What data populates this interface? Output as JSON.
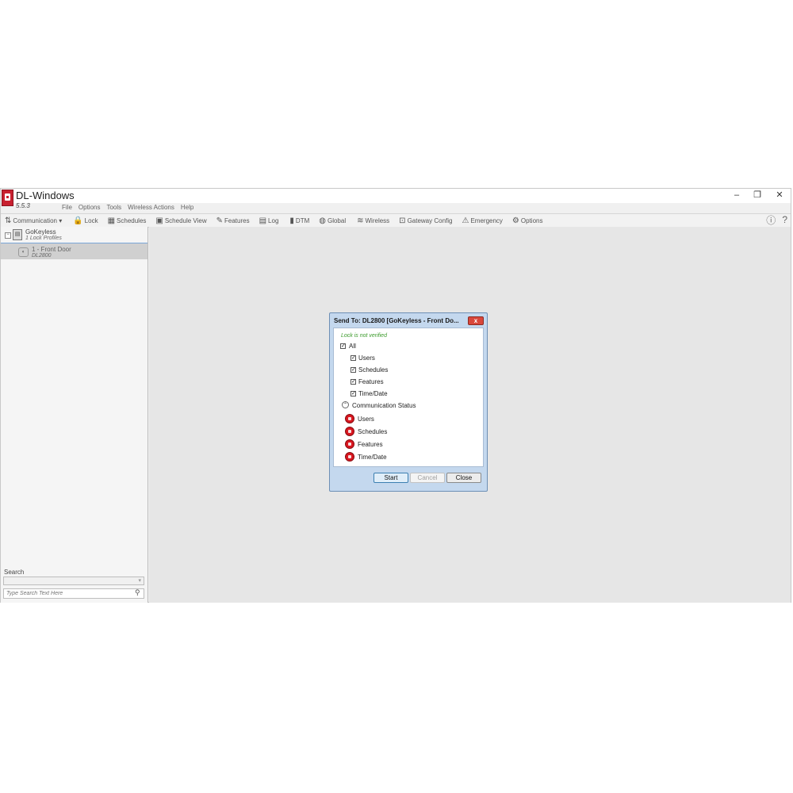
{
  "window": {
    "title": "DL-Windows",
    "version": "5.5.3",
    "controls": [
      "–",
      "❐",
      "✕"
    ]
  },
  "menu": [
    "File",
    "Options",
    "Tools",
    "Wireless Actions",
    "Help"
  ],
  "toolbar": [
    {
      "label": "Communication ▾",
      "icon": "communication-icon",
      "glyph": "⇅"
    },
    {
      "label": "Lock",
      "icon": "lock-icon",
      "glyph": "🔒"
    },
    {
      "label": "Schedules",
      "icon": "schedules-icon",
      "glyph": "▦"
    },
    {
      "label": "Schedule View",
      "icon": "calendar-icon",
      "glyph": "▣"
    },
    {
      "label": "Features",
      "icon": "tools-icon",
      "glyph": "✎"
    },
    {
      "label": "Log",
      "icon": "log-icon",
      "glyph": "▤"
    },
    {
      "label": "DTM",
      "icon": "dtm-icon",
      "glyph": "▮"
    },
    {
      "label": "Global",
      "icon": "globe-icon",
      "glyph": "◍"
    },
    {
      "label": "Wireless",
      "icon": "wireless-icon",
      "glyph": "≋"
    },
    {
      "label": "Gateway Config",
      "icon": "gateway-icon",
      "glyph": "⊡"
    },
    {
      "label": "Emergency",
      "icon": "emergency-icon",
      "glyph": "⚠"
    },
    {
      "label": "Options",
      "icon": "gear-icon",
      "glyph": "⚙"
    }
  ],
  "help_icons": {
    "info": "ⓘ",
    "help": "?"
  },
  "tree": {
    "expander": "−",
    "profile_icon": "▤",
    "profile_name": "GoKeyless",
    "profile_sub": "1 Lock Profiles",
    "lock_icon": "◐",
    "lock_name": "1 - Front Door",
    "lock_model": "DL2800"
  },
  "search": {
    "label": "Search",
    "dropdown_arrow": "▾",
    "placeholder": "Type Search Text Here",
    "icon": "⚲"
  },
  "dialog": {
    "title": "Send To: DL2800 [GoKeyless - Front Do...",
    "close_glyph": "x",
    "status_message": "Lock is not verified",
    "all_label": "All",
    "check_glyph": "✓",
    "items": [
      "Users",
      "Schedules",
      "Features",
      "Time/Date"
    ],
    "comm_toggle": "⌃",
    "comm_label": "Communication Status",
    "comm_items": [
      "Users",
      "Schedules",
      "Features",
      "Time/Date"
    ],
    "buttons": {
      "start": "Start",
      "cancel": "Cancel",
      "close": "Close"
    }
  },
  "colors": {
    "status_ok_text": "#3a9a2a",
    "status_error": "#d8161f",
    "dialog_frame": "#c4d8ee"
  }
}
